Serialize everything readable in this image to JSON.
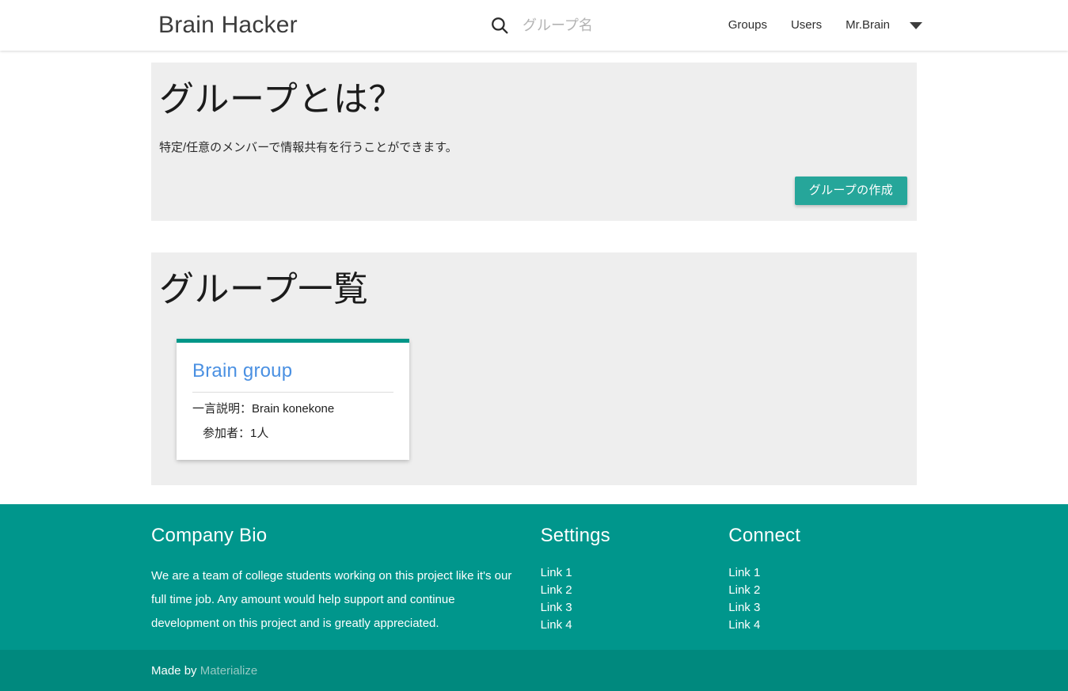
{
  "navbar": {
    "brand": "Brain Hacker",
    "search": {
      "icon": "search-icon",
      "placeholder": "グループ名",
      "value": ""
    },
    "links": [
      {
        "label": "Groups"
      },
      {
        "label": "Users"
      },
      {
        "label": "Mr.Brain"
      }
    ],
    "dropdown_icon": "chevron-down-icon"
  },
  "about_panel": {
    "heading": "グループとは？",
    "description": "特定/任意のメンバーで情報共有を行うことができます。",
    "create_button": "グループの作成"
  },
  "list_panel": {
    "heading": "グループ一覧",
    "cards": [
      {
        "title": "Brain group",
        "description_line": "一言説明：Brain konekone",
        "members_line": "参加者：1人"
      }
    ]
  },
  "footer": {
    "bio": {
      "heading": "Company Bio",
      "text": "We are a team of college students working on this project like it's our full time job. Any amount would help support and continue development on this project and is greatly appreciated."
    },
    "columns": [
      {
        "heading": "Settings",
        "links": [
          "Link 1",
          "Link 2",
          "Link 3",
          "Link 4"
        ]
      },
      {
        "heading": "Connect",
        "links": [
          "Link 1",
          "Link 2",
          "Link 3",
          "Link 4"
        ]
      }
    ],
    "copyright_prefix": "Made by ",
    "copyright_link": "Materialize"
  },
  "colors": {
    "accent_teal": "#26a69a",
    "footer_teal": "#00968c",
    "footer_copy_teal": "#00897e",
    "card_border_teal": "#009688",
    "link_blue": "#4a90e2",
    "panel_gray": "#eeeeee"
  }
}
